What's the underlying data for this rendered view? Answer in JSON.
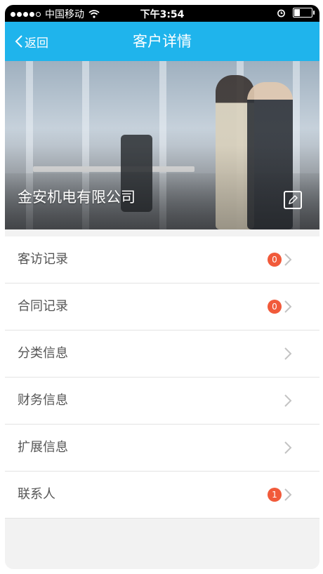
{
  "status_bar": {
    "carrier": "中国移动",
    "time": "下午3:54"
  },
  "nav": {
    "back_label": "返回",
    "title": "客户详情"
  },
  "header": {
    "company_name": "金安机电有限公司"
  },
  "menu": {
    "items": [
      {
        "label": "客访记录",
        "badge": "0"
      },
      {
        "label": "合同记录",
        "badge": "0"
      },
      {
        "label": "分类信息"
      },
      {
        "label": "财务信息"
      },
      {
        "label": "扩展信息"
      },
      {
        "label": "联系人",
        "badge": "1"
      }
    ]
  },
  "colors": {
    "nav_bar": "#1fb4ec",
    "badge": "#f15a3a"
  }
}
